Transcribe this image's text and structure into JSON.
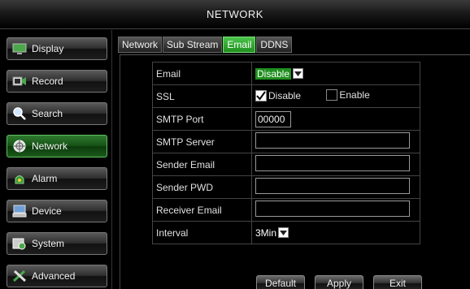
{
  "header": {
    "title": "NETWORK"
  },
  "sidebar": {
    "items": [
      {
        "label": "Display",
        "icon": "monitor-icon"
      },
      {
        "label": "Record",
        "icon": "camera-icon"
      },
      {
        "label": "Search",
        "icon": "magnifier-icon"
      },
      {
        "label": "Network",
        "icon": "network-icon"
      },
      {
        "label": "Alarm",
        "icon": "alarm-icon"
      },
      {
        "label": "Device",
        "icon": "device-icon"
      },
      {
        "label": "System",
        "icon": "system-icon"
      },
      {
        "label": "Advanced",
        "icon": "tools-icon"
      }
    ],
    "active": "Network"
  },
  "tabs": [
    {
      "label": "Network"
    },
    {
      "label": "Sub Stream"
    },
    {
      "label": "Email"
    },
    {
      "label": "DDNS"
    }
  ],
  "active_tab": "Email",
  "form": {
    "email_label": "Email",
    "email_value": "Disable",
    "ssl_label": "SSL",
    "ssl_disable_label": "Disable",
    "ssl_enable_label": "Enable",
    "smtp_port_label": "SMTP Port",
    "smtp_port_value": "00000",
    "smtp_server_label": "SMTP Server",
    "smtp_server_value": "",
    "sender_email_label": "Sender Email",
    "sender_email_value": "",
    "sender_pwd_label": "Sender PWD",
    "sender_pwd_value": "",
    "receiver_email_label": "Receiver Email",
    "receiver_email_value": "",
    "interval_label": "Interval",
    "interval_value": "3Min"
  },
  "buttons": {
    "default": "Default",
    "apply": "Apply",
    "exit": "Exit"
  },
  "colors": {
    "accent": "#1f8f1f",
    "active_border": "#5fbf5f",
    "background": "#000000"
  }
}
